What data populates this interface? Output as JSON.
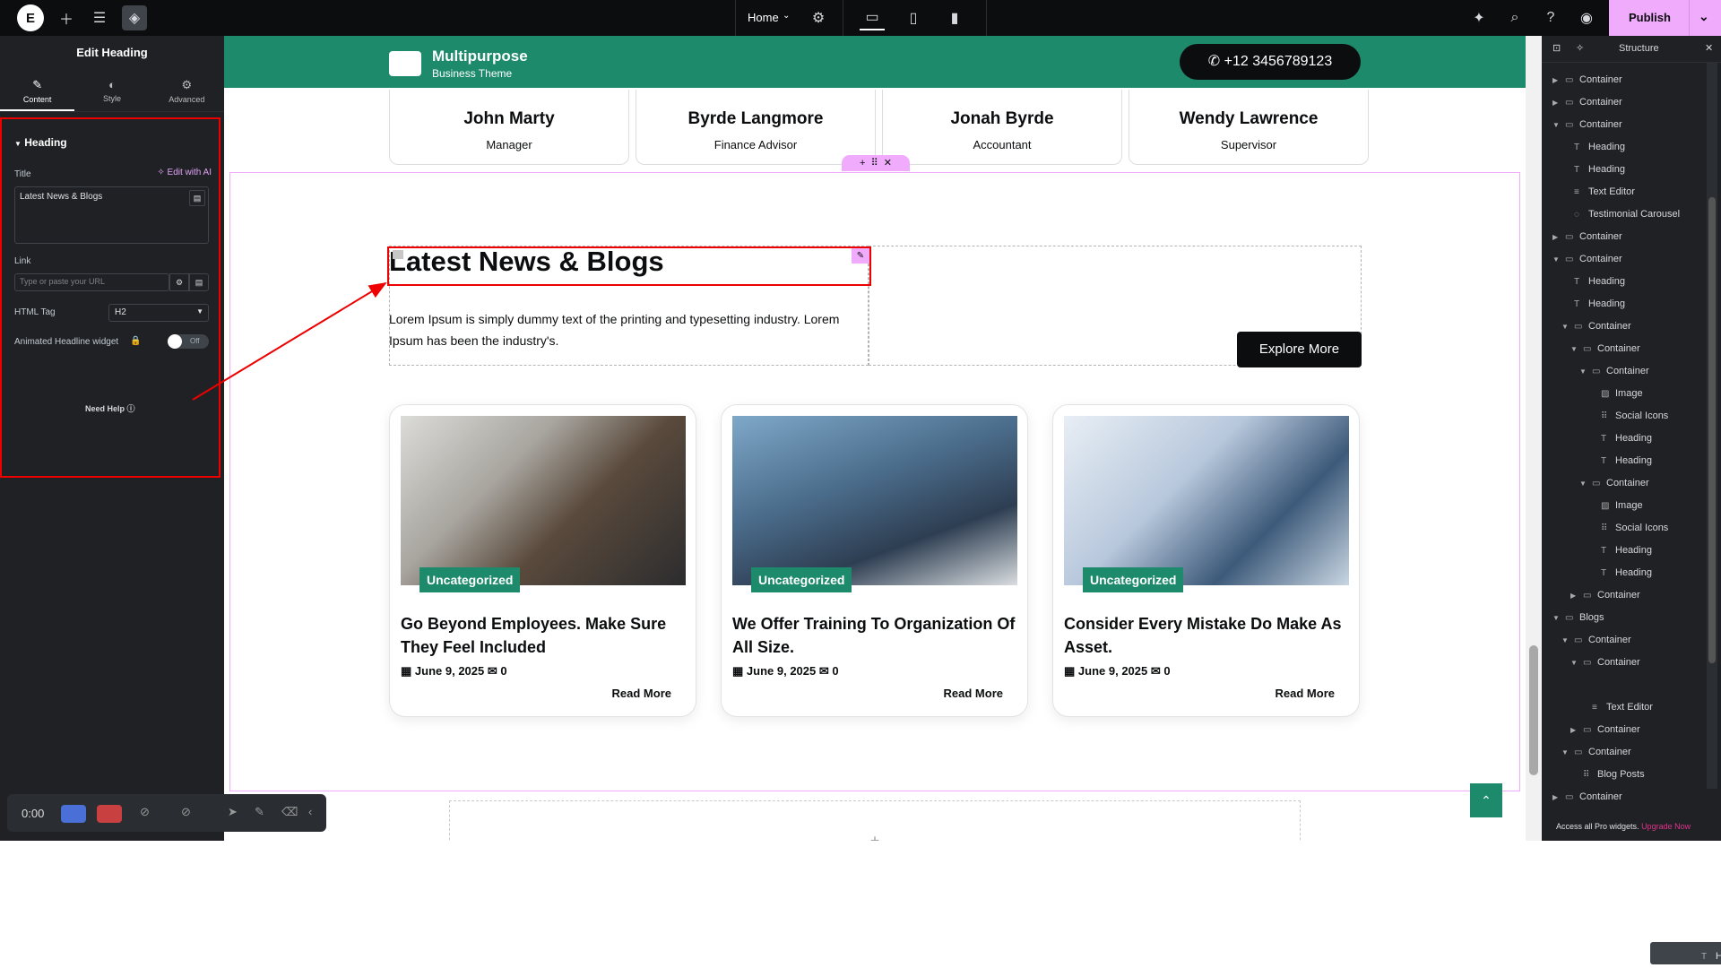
{
  "topbar": {
    "logo": "E",
    "add_icon": "plus-icon",
    "settings_icon": "sliders-icon",
    "layers_icon": "layers-icon",
    "page_name": "Home",
    "page_settings_icon": "gear-icon",
    "devices": [
      "desktop-icon",
      "tablet-icon",
      "mobile-icon"
    ],
    "publish_label": "Publish",
    "right_icons": [
      "notifications-icon",
      "search-icon",
      "help-icon",
      "preview-icon"
    ]
  },
  "panel": {
    "title": "Edit Heading",
    "tabs": [
      {
        "label": "Content",
        "icon": "pencil-icon"
      },
      {
        "label": "Style",
        "icon": "contrast-icon"
      },
      {
        "label": "Advanced",
        "icon": "gear-icon"
      }
    ],
    "section_title": "Heading",
    "title_label": "Title",
    "edit_ai_label": "Edit with AI",
    "title_value": "Latest News & Blogs",
    "link_label": "Link",
    "link_placeholder": "Type or paste your URL",
    "html_tag_label": "HTML Tag",
    "html_tag_value": "H2",
    "animated_label": "Animated Headline widget",
    "toggle_label": "Off",
    "need_help": "Need Help"
  },
  "site": {
    "brand_name": "Multipurpose",
    "brand_sub": "Business Theme",
    "phone": "+12 3456789123",
    "team": [
      {
        "name": "John Marty",
        "role": "Manager"
      },
      {
        "name": "Byrde Langmore",
        "role": "Finance Advisor"
      },
      {
        "name": "Jonah Byrde",
        "role": "Accountant"
      },
      {
        "name": "Wendy Lawrence",
        "role": "Supervisor"
      }
    ],
    "heading": "Latest News & Blogs",
    "lorem": "Lorem Ipsum is simply dummy text of the printing and typesetting industry. Lorem Ipsum has been the industry's.",
    "explore": "Explore More",
    "posts": [
      {
        "category": "Uncategorized",
        "title": "Go Beyond Employees. Make Sure They Feel Included",
        "date": "June 9, 2025",
        "comments": "0",
        "read_more": "Read More"
      },
      {
        "category": "Uncategorized",
        "title": "We Offer Training To Organization Of All Size.",
        "date": "June 9, 2025",
        "comments": "0",
        "read_more": "Read More"
      },
      {
        "category": "Uncategorized",
        "title": "Consider Every Mistake Do Make As Asset.",
        "date": "June 9, 2025",
        "comments": "0",
        "read_more": "Read More"
      }
    ],
    "add_section": "+"
  },
  "structure": {
    "title": "Structure",
    "nodes": [
      {
        "label": "Container",
        "depth": 0,
        "arrow": "right"
      },
      {
        "label": "Container",
        "depth": 0,
        "arrow": "right"
      },
      {
        "label": "Container",
        "depth": 0,
        "arrow": "down"
      },
      {
        "label": "Heading",
        "depth": 1,
        "arrow": ""
      },
      {
        "label": "Heading",
        "depth": 1,
        "arrow": ""
      },
      {
        "label": "Text Editor",
        "depth": 1,
        "arrow": ""
      },
      {
        "label": "Testimonial Carousel",
        "depth": 1,
        "arrow": ""
      },
      {
        "label": "Container",
        "depth": 0,
        "arrow": "right"
      },
      {
        "label": "Container",
        "depth": 0,
        "arrow": "down"
      },
      {
        "label": "Heading",
        "depth": 1,
        "arrow": ""
      },
      {
        "label": "Heading",
        "depth": 1,
        "arrow": ""
      },
      {
        "label": "Container",
        "depth": 1,
        "arrow": "down"
      },
      {
        "label": "Container",
        "depth": 2,
        "arrow": "down"
      },
      {
        "label": "Container",
        "depth": 3,
        "arrow": "down"
      },
      {
        "label": "Image",
        "depth": 4,
        "arrow": ""
      },
      {
        "label": "Social Icons",
        "depth": 4,
        "arrow": ""
      },
      {
        "label": "Heading",
        "depth": 4,
        "arrow": ""
      },
      {
        "label": "Heading",
        "depth": 4,
        "arrow": ""
      },
      {
        "label": "Container",
        "depth": 3,
        "arrow": "down"
      },
      {
        "label": "Image",
        "depth": 4,
        "arrow": ""
      },
      {
        "label": "Social Icons",
        "depth": 4,
        "arrow": ""
      },
      {
        "label": "Heading",
        "depth": 4,
        "arrow": ""
      },
      {
        "label": "Heading",
        "depth": 4,
        "arrow": ""
      },
      {
        "label": "Container",
        "depth": 2,
        "arrow": "right"
      },
      {
        "label": "Blogs",
        "depth": 0,
        "arrow": "down"
      },
      {
        "label": "Container",
        "depth": 1,
        "arrow": "down"
      },
      {
        "label": "Container",
        "depth": 2,
        "arrow": "down"
      },
      {
        "label": "Heading",
        "depth": 3,
        "arrow": "",
        "selected": true
      },
      {
        "label": "Text Editor",
        "depth": 3,
        "arrow": ""
      },
      {
        "label": "Container",
        "depth": 2,
        "arrow": "right"
      },
      {
        "label": "Container",
        "depth": 1,
        "arrow": "down"
      },
      {
        "label": "Blog Posts",
        "depth": 2,
        "arrow": ""
      },
      {
        "label": "Container",
        "depth": 0,
        "arrow": "right"
      }
    ],
    "pro_text": "Access all Pro widgets.",
    "upgrade": "Upgrade Now"
  },
  "recorder": {
    "time": "0:00"
  },
  "colors": {
    "brand_green": "#1e8a6c",
    "accent_pink": "#f0abfc",
    "panel_bg": "#1f2124",
    "highlight_red": "#e00000"
  }
}
